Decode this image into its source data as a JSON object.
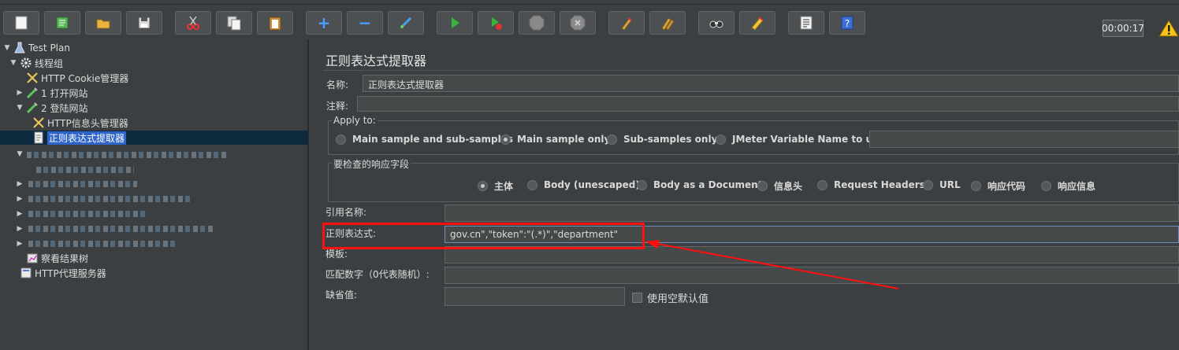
{
  "toolbar": {
    "buttons": [
      {
        "name": "new-icon"
      },
      {
        "name": "templates-icon"
      },
      {
        "name": "open-icon"
      },
      {
        "name": "save-icon"
      },
      {
        "name": "cut-icon"
      },
      {
        "name": "copy-icon"
      },
      {
        "name": "paste-icon"
      },
      {
        "name": "expand-icon",
        "glyph": "+"
      },
      {
        "name": "collapse-icon",
        "glyph": "−"
      },
      {
        "name": "toggle-icon"
      },
      {
        "name": "start-icon"
      },
      {
        "name": "start-no-pause-icon"
      },
      {
        "name": "stop-icon"
      },
      {
        "name": "shutdown-icon"
      },
      {
        "name": "clear-icon"
      },
      {
        "name": "clear-all-icon"
      },
      {
        "name": "search-icon"
      },
      {
        "name": "reset-search-icon"
      },
      {
        "name": "function-helper-icon"
      },
      {
        "name": "help-icon"
      }
    ],
    "timer": "00:00:17",
    "warning_icon": "warning-icon"
  },
  "tree": {
    "test_plan": "Test Plan",
    "thread_group": "线程组",
    "cookie_manager": "HTTP Cookie管理器",
    "sampler_1": "1 打开网站",
    "sampler_2": "2 登陆网站",
    "header_manager": "HTTP信息头管理器",
    "regex_extractor": "正则表达式提取器",
    "results_tree": "察看结果树",
    "proxy_server": "HTTP代理服务器"
  },
  "panel": {
    "title": "正则表达式提取器",
    "name_label": "名称:",
    "name_value": "正则表达式提取器",
    "comment_label": "注释:",
    "apply_to": {
      "legend": "Apply to:",
      "options": [
        "Main sample and sub-samples",
        "Main sample only",
        "Sub-samples only",
        "JMeter Variable Name to use"
      ],
      "selected": "Main sample only"
    },
    "field_to_check": {
      "legend": "要检查的响应字段",
      "options": [
        "主体",
        "Body (unescaped)",
        "Body as a Document",
        "信息头",
        "Request Headers",
        "URL",
        "响应代码",
        "响应信息"
      ],
      "selected": "主体"
    },
    "ref_name_label": "引用名称:",
    "regex_label": "正则表达式:",
    "regex_value": "gov.cn\",\"token\":\"(.*)\",\"department\"",
    "template_label": "模板:",
    "match_no_label": "匹配数字（0代表随机）:",
    "default_label": "缺省值:",
    "use_empty_default": "使用空默认值"
  },
  "annotation": {
    "color": "#ff1010"
  }
}
